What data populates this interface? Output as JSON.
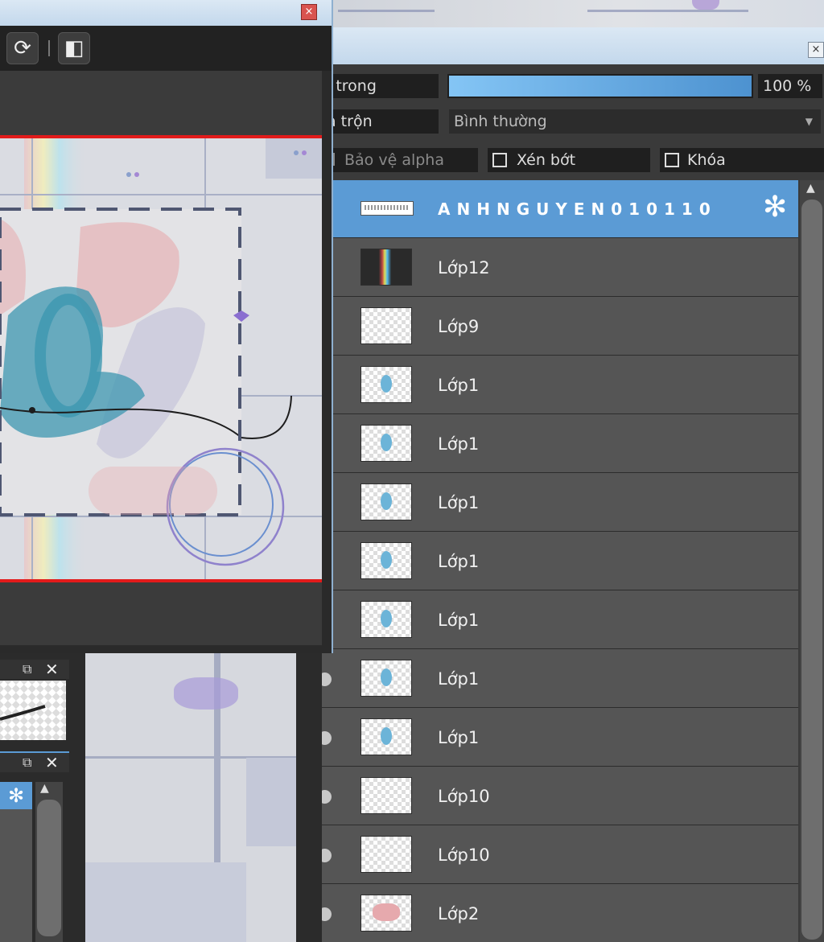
{
  "nav_window": {
    "close_glyph": "×"
  },
  "layers_panel": {
    "close_glyph": "×",
    "opacity_label": "i trong",
    "opacity_value": "100 %",
    "opacity_fraction": 1.0,
    "blend_label": "a trộn",
    "blend_value": "Bình thường",
    "protect_alpha_label": "Bảo vệ alpha",
    "clip_label": "Xén bớt",
    "lock_label": "Khóa",
    "layers": [
      {
        "name": "ANHNGUYEN010110",
        "selected": true
      },
      {
        "name": "Lớp12"
      },
      {
        "name": "Lớp9"
      },
      {
        "name": "Lớp1"
      },
      {
        "name": "Lớp1"
      },
      {
        "name": "Lớp1"
      },
      {
        "name": "Lớp1"
      },
      {
        "name": "Lớp1"
      },
      {
        "name": "Lớp1"
      },
      {
        "name": "Lớp1"
      },
      {
        "name": "Lớp10"
      },
      {
        "name": "Lớp10"
      },
      {
        "name": "Lớp2"
      }
    ]
  },
  "colors": {
    "selection": "#5b9bd5",
    "canvas_border": "#e21b1b"
  }
}
